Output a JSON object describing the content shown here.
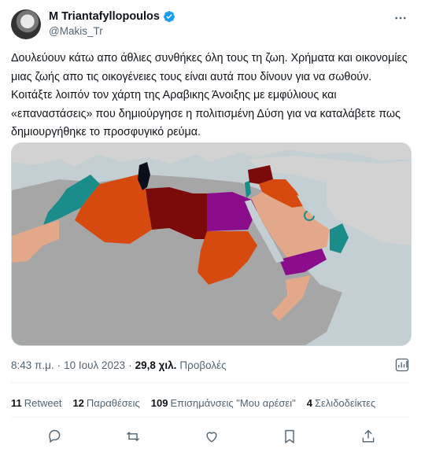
{
  "author": {
    "name": "M Triantafyllopoulos",
    "handle": "@Makis_Tr",
    "verified_badge_color": "#1d9bf0"
  },
  "icons": {
    "more": "more-horizontal-icon",
    "verified": "verified-badge-icon",
    "analytics": "analytics-icon",
    "reply": "reply-icon",
    "retweet": "retweet-icon",
    "like": "heart-icon",
    "bookmark": "bookmark-icon",
    "share": "share-icon"
  },
  "tweet": {
    "text": "Δουλεύουν κάτω απο άθλιες συνθήκες όλη τους τη ζωη. Χρήματα και οικονομίες μιας ζωής απο τις οικογένειες τους είναι αυτά που δίνουν  για να σωθούν. Κοιτάξτε λοιπόν τον χάρτη της Αραβικης Άνοιξης με εμφύλιους και «επαναστάσεις» που δημιούργησε η πολιτισμένη Δύση για να καταλάβετε πως δημιουργήθηκε το προσφυγικό ρεύμα."
  },
  "media": {
    "type": "map",
    "colors": {
      "sea": "#c4cfd3",
      "land": "#a6a6a6",
      "nearby_land": "#d2d2d2",
      "teal": "#1a8d8a",
      "orange": "#d64a0f",
      "darkred": "#7b0b0b",
      "purple": "#8b0d8c",
      "tan": "#e3a889",
      "black": "#0b0f1a"
    }
  },
  "meta": {
    "time": "8:43 π.μ.",
    "separator1": "·",
    "date": "10 Ιουλ 2023",
    "separator2": "·",
    "views_count": "29,8 χιλ.",
    "views_label": "Προβολές"
  },
  "stats": [
    {
      "num": "11",
      "label": "Retweet"
    },
    {
      "num": "12",
      "label": "Παραθέσεις"
    },
    {
      "num": "109",
      "label": "Επισημάνσεις \"Μου αρέσει\""
    },
    {
      "num": "4",
      "label": "Σελιδοδείκτες"
    }
  ]
}
